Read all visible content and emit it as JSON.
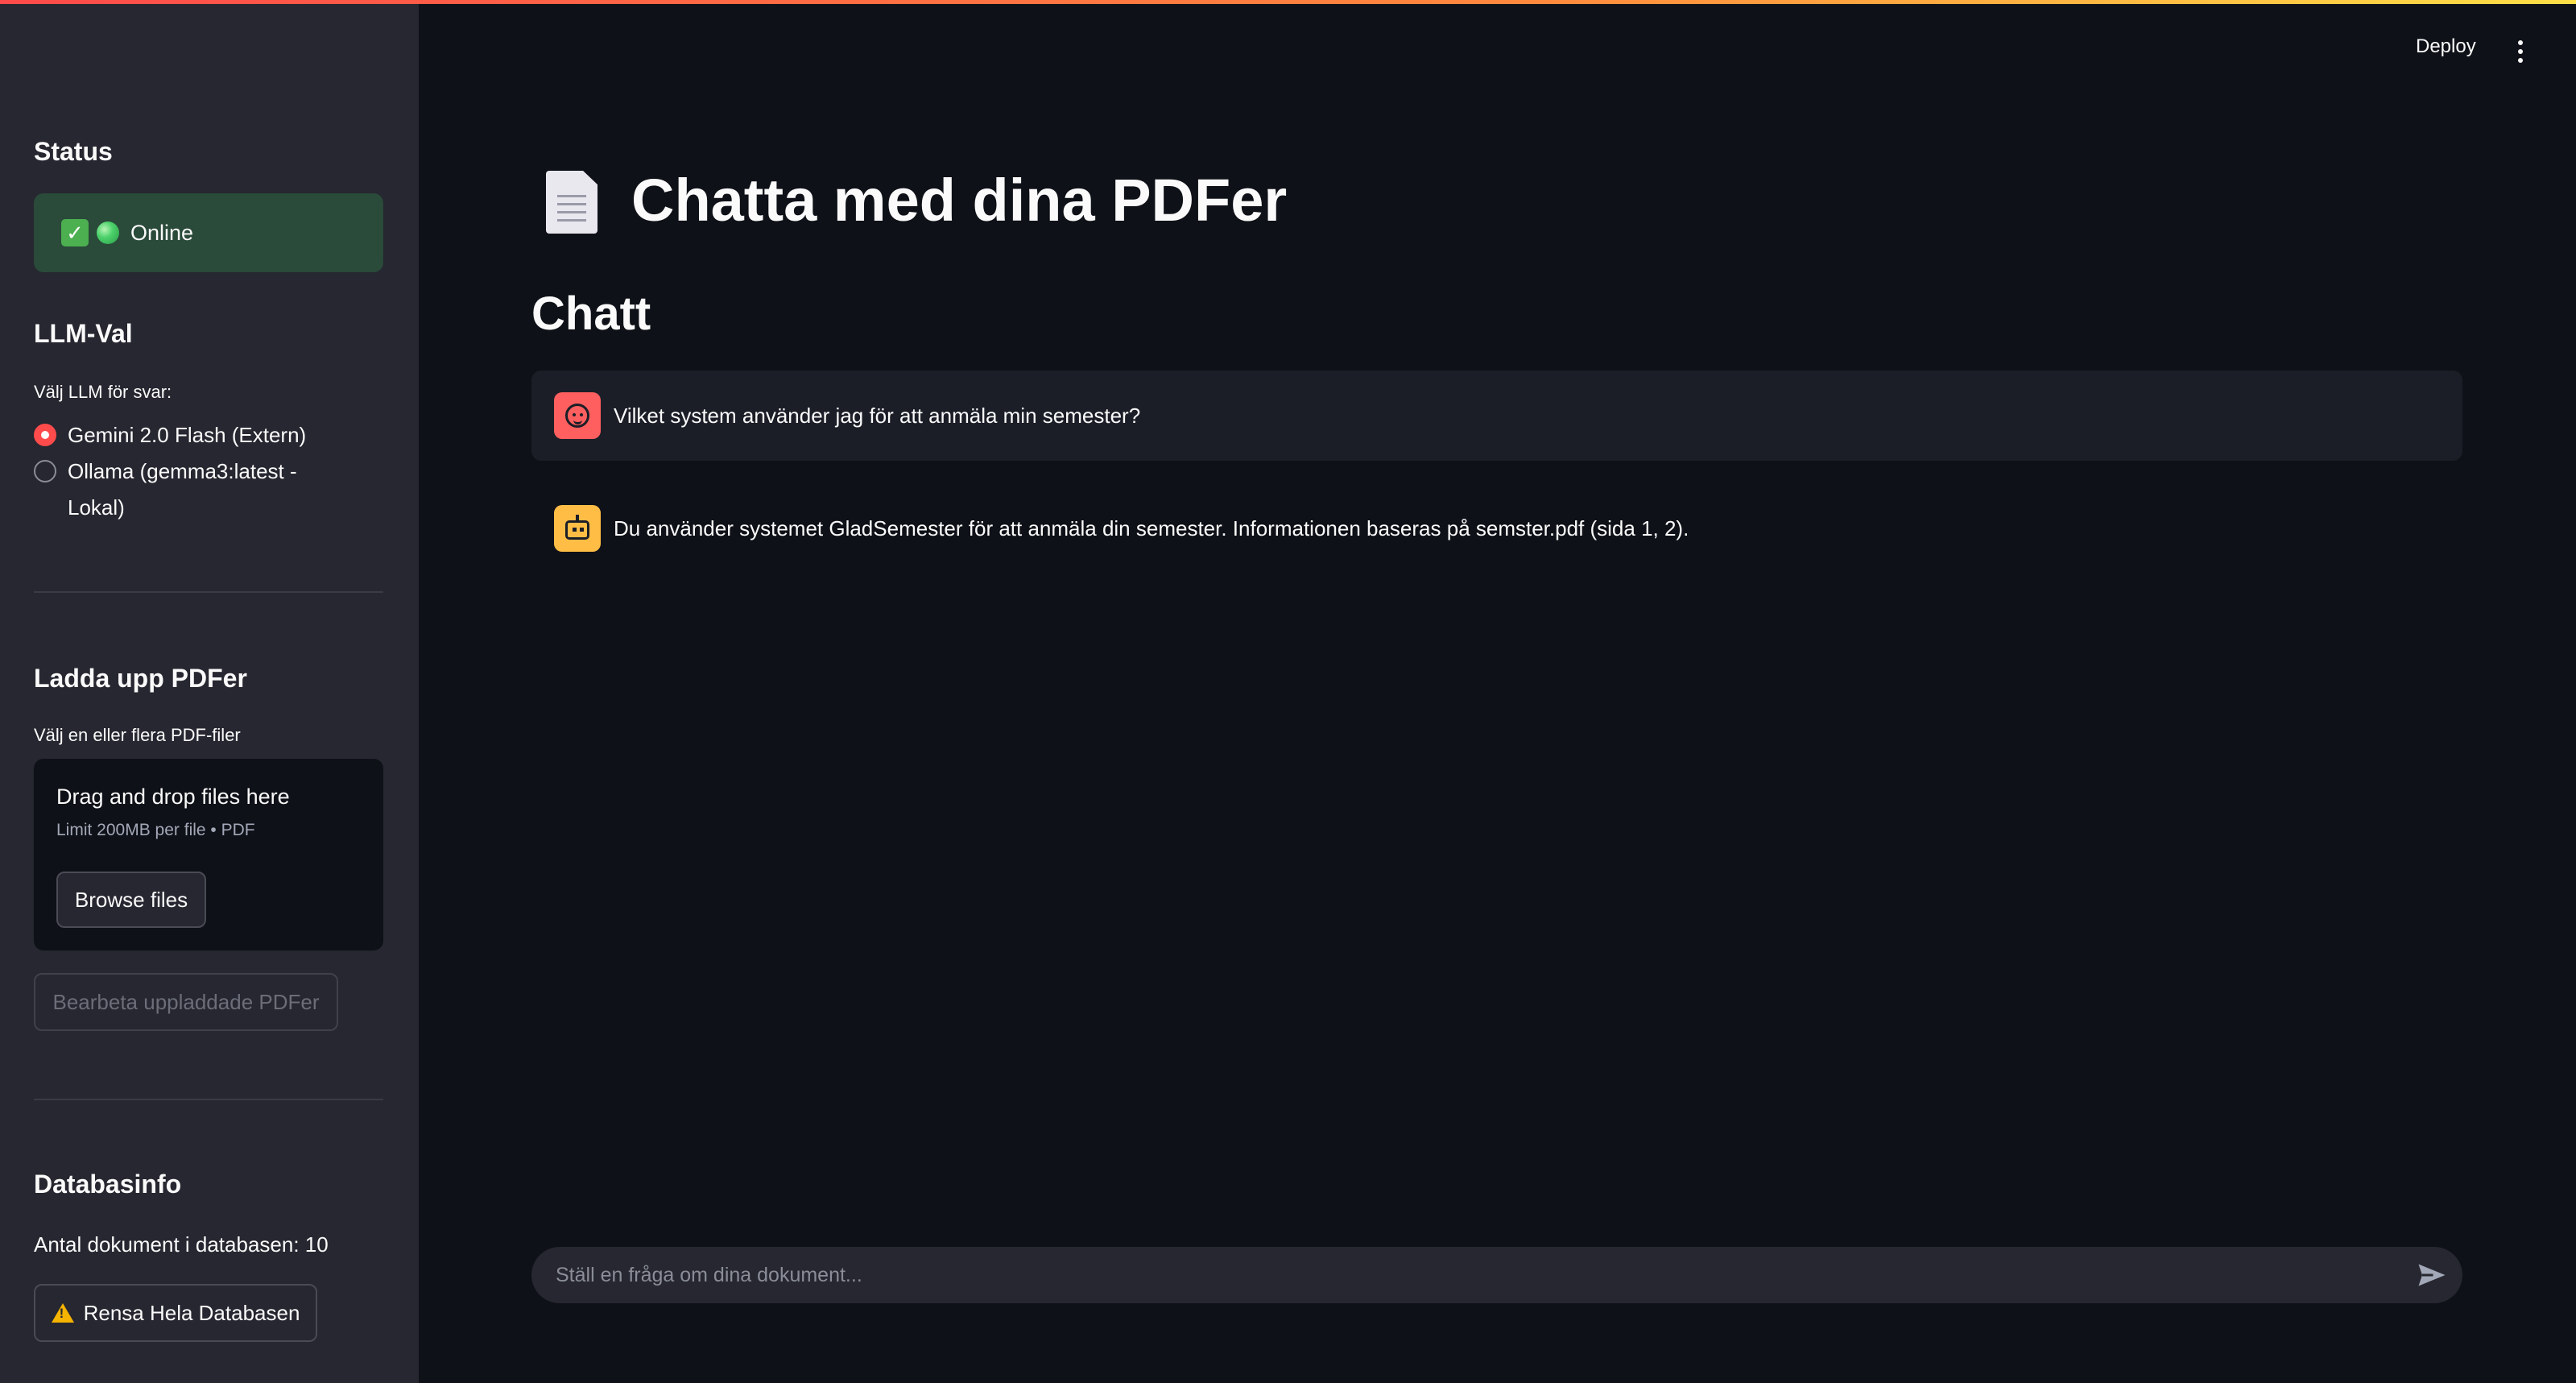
{
  "sidebar": {
    "status_heading": "Status",
    "status_text": "Online",
    "llm_heading": "LLM-Val",
    "llm_label": "Välj LLM för svar:",
    "llm_options": [
      {
        "label": "Gemini 2.0 Flash (Extern)",
        "selected": true
      },
      {
        "label_line1": "Ollama (gemma3:latest -",
        "label_line2": "Lokal)",
        "selected": false
      }
    ],
    "upload_heading": "Ladda upp PDFer",
    "upload_label": "Välj en eller flera PDF-filer",
    "dropzone_title": "Drag and drop files here",
    "dropzone_limit": "Limit 200MB per file • PDF",
    "browse_button": "Browse files",
    "process_button": "Bearbeta uppladdade PDFer",
    "db_heading": "Databasinfo",
    "db_count": "Antal dokument i databasen: 10",
    "clear_button": "Rensa Hela Databasen"
  },
  "header": {
    "deploy_label": "Deploy"
  },
  "main": {
    "title": "Chatta med dina PDFer",
    "section_title": "Chatt",
    "messages": [
      {
        "role": "user",
        "text": "Vilket system använder jag för att anmäla min semester?"
      },
      {
        "role": "assistant",
        "text": "Du använder systemet GladSemester för att anmäla din semester. Informationen baseras på semster.pdf (sida 1, 2)."
      }
    ],
    "input_placeholder": "Ställ en fråga om dina dokument..."
  },
  "colors": {
    "accent": "#ff4b4b",
    "sidebar_bg": "#262730",
    "main_bg": "#0e1117",
    "status_bg": "#2a4a3a",
    "user_avatar": "#ff5f5f",
    "bot_avatar": "#ffbd45"
  },
  "icons": [
    "check-icon",
    "green-dot-icon",
    "warning-icon",
    "kebab-menu-icon",
    "document-icon",
    "user-face-icon",
    "robot-icon",
    "send-icon"
  ]
}
